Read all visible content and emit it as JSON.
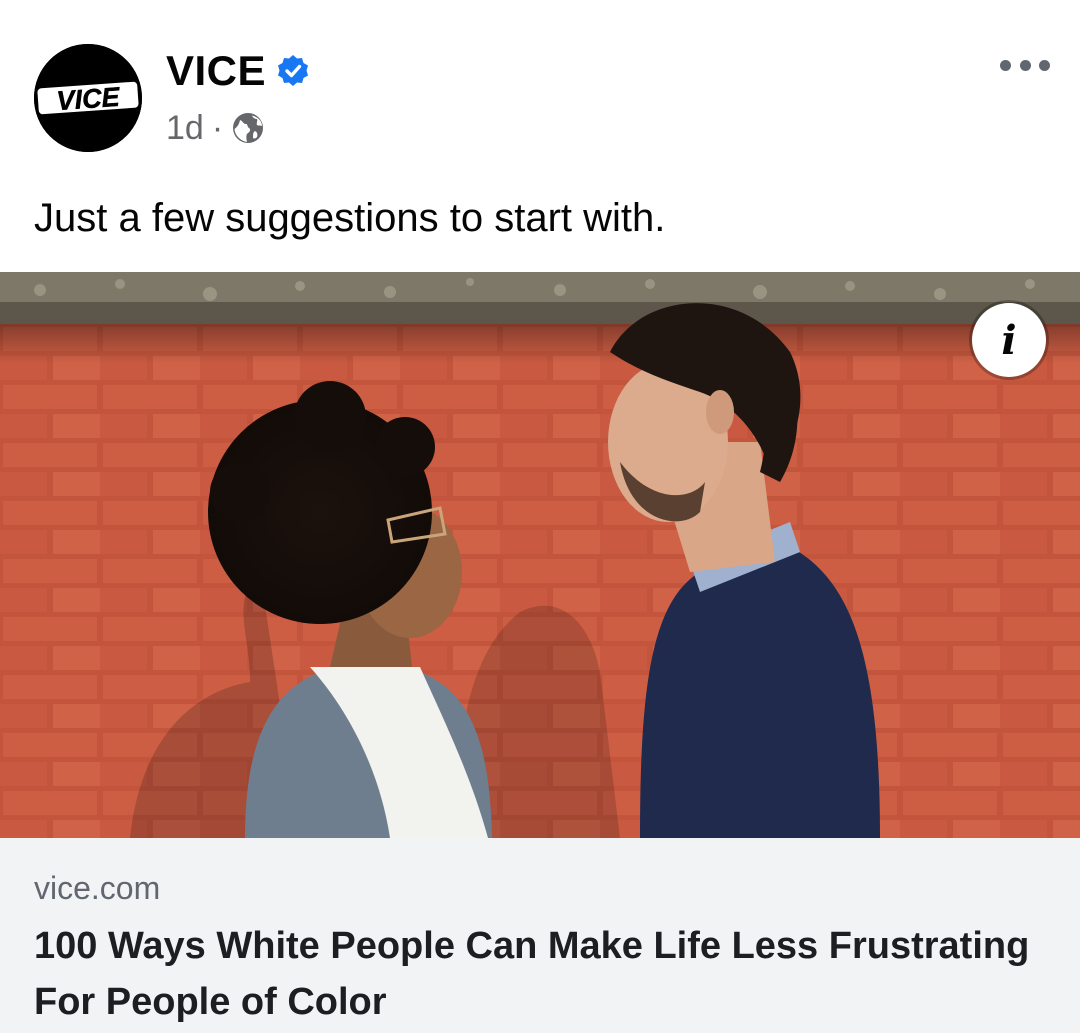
{
  "post": {
    "page_name": "VICE",
    "avatar_logo_text": "VICE",
    "time": "1d",
    "separator": "·",
    "audience_icon": "globe-icon",
    "verified_icon": "verified-badge-icon",
    "more_icon": "more-options-icon",
    "caption": "Just a few suggestions to start with."
  },
  "image": {
    "info_label": "i",
    "info_icon": "info-icon"
  },
  "link_preview": {
    "domain": "vice.com",
    "title": "100 Ways White People Can Make Life Less Frustrating For People of Color"
  },
  "colors": {
    "verified_blue": "#1877f2",
    "secondary_text": "#65676b",
    "link_box_bg": "#f2f3f5",
    "brick": "#c85a40"
  }
}
